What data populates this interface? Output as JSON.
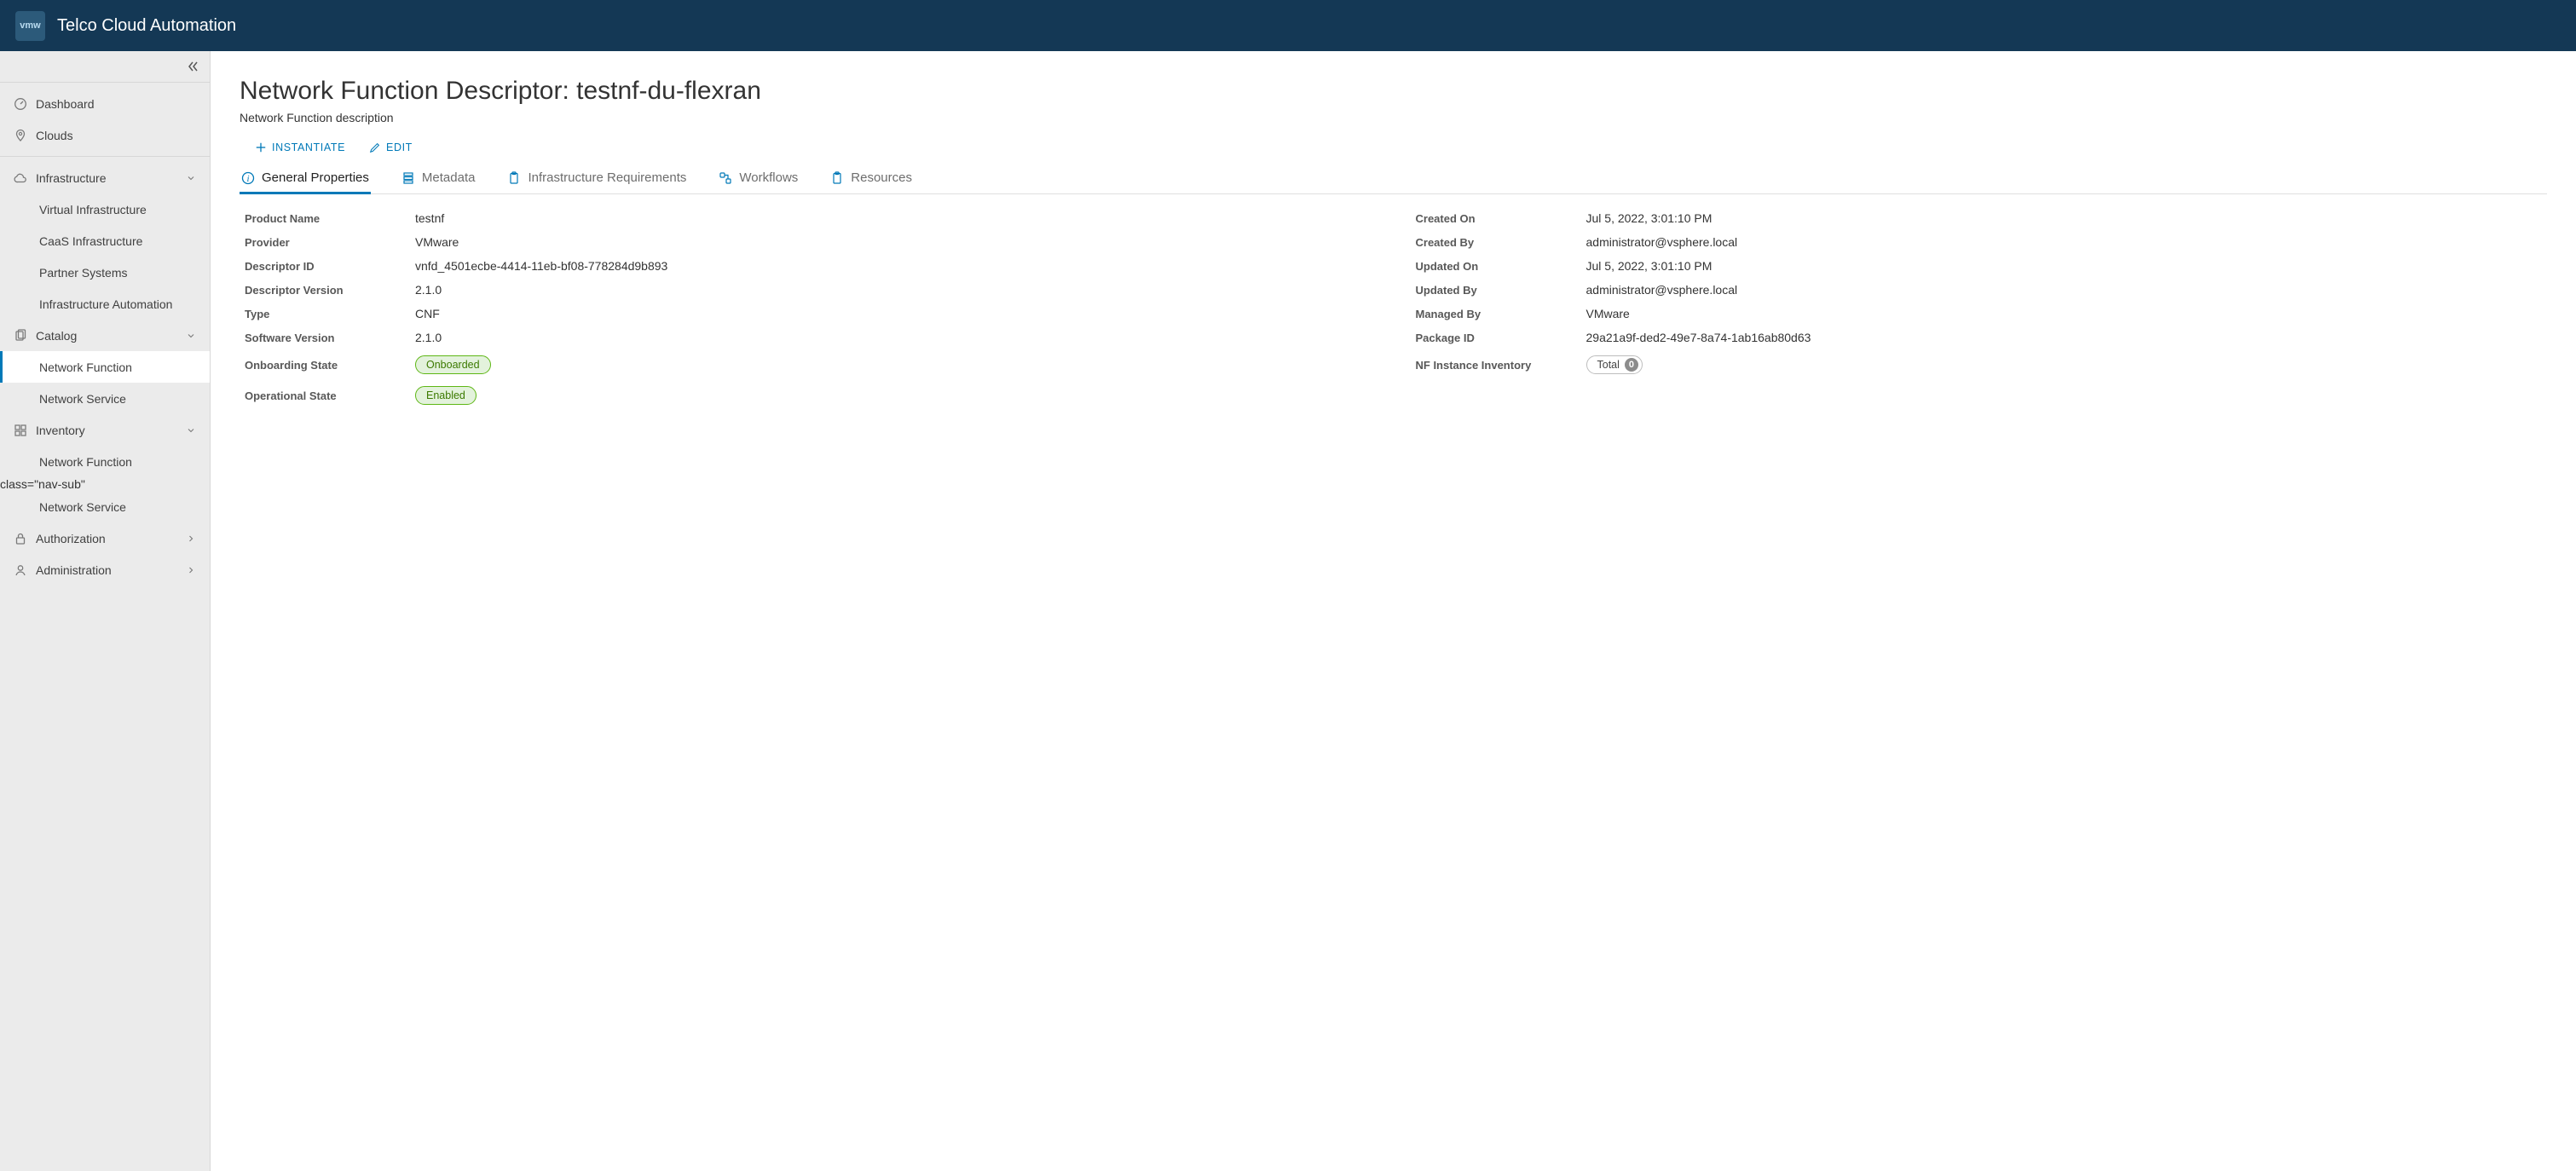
{
  "header": {
    "brand_short": "vmw",
    "title": "Telco Cloud Automation"
  },
  "sidebar": {
    "top": [
      {
        "label": "Dashboard",
        "icon": "gauge-icon"
      },
      {
        "label": "Clouds",
        "icon": "pin-icon"
      }
    ],
    "infrastructure": {
      "label": "Infrastructure",
      "icon": "cloud-icon",
      "items": [
        {
          "label": "Virtual Infrastructure"
        },
        {
          "label": "CaaS Infrastructure"
        },
        {
          "label": "Partner Systems"
        },
        {
          "label": "Infrastructure Automation"
        }
      ]
    },
    "catalog": {
      "label": "Catalog",
      "icon": "copy-icon",
      "items": [
        {
          "label": "Network Function",
          "active": true
        },
        {
          "label": "Network Service"
        }
      ]
    },
    "inventory": {
      "label": "Inventory",
      "icon": "grid-icon",
      "items": [
        {
          "label": "Network Function"
        },
        {
          "label": "Network Service"
        }
      ]
    },
    "authorization": {
      "label": "Authorization",
      "icon": "lock-icon"
    },
    "administration": {
      "label": "Administration",
      "icon": "user-icon"
    }
  },
  "page": {
    "title": "Network Function Descriptor: testnf-du-flexran",
    "subtitle": "Network Function description"
  },
  "actions": {
    "instantiate": "INSTANTIATE",
    "edit": "EDIT"
  },
  "tabs": [
    {
      "label": "General Properties",
      "icon": "info-icon",
      "active": true
    },
    {
      "label": "Metadata",
      "icon": "stacked-icon",
      "active": false
    },
    {
      "label": "Infrastructure Requirements",
      "icon": "clipboard-icon",
      "active": false
    },
    {
      "label": "Workflows",
      "icon": "workflow-icon",
      "active": false
    },
    {
      "label": "Resources",
      "icon": "clipboard2-icon",
      "active": false
    }
  ],
  "props": {
    "left": {
      "product_name": {
        "label": "Product Name",
        "value": "testnf"
      },
      "provider": {
        "label": "Provider",
        "value": "VMware"
      },
      "descriptor_id": {
        "label": "Descriptor ID",
        "value": "vnfd_4501ecbe-4414-11eb-bf08-778284d9b893"
      },
      "descriptor_version": {
        "label": "Descriptor Version",
        "value": "2.1.0"
      },
      "type": {
        "label": "Type",
        "value": "CNF"
      },
      "software_version": {
        "label": "Software Version",
        "value": "2.1.0"
      },
      "onboarding_state": {
        "label": "Onboarding State",
        "badge": "Onboarded"
      },
      "operational_state": {
        "label": "Operational State",
        "badge": "Enabled"
      }
    },
    "right": {
      "created_on": {
        "label": "Created On",
        "value": "Jul 5, 2022, 3:01:10 PM"
      },
      "created_by": {
        "label": "Created By",
        "value": "administrator@vsphere.local"
      },
      "updated_on": {
        "label": "Updated On",
        "value": "Jul 5, 2022, 3:01:10 PM"
      },
      "updated_by": {
        "label": "Updated By",
        "value": "administrator@vsphere.local"
      },
      "managed_by": {
        "label": "Managed By",
        "value": "VMware"
      },
      "package_id": {
        "label": "Package ID",
        "value": "29a21a9f-ded2-49e7-8a74-1ab16ab80d63"
      },
      "nf_inventory": {
        "label": "NF Instance Inventory",
        "counter_label": "Total",
        "count": "0"
      }
    }
  }
}
